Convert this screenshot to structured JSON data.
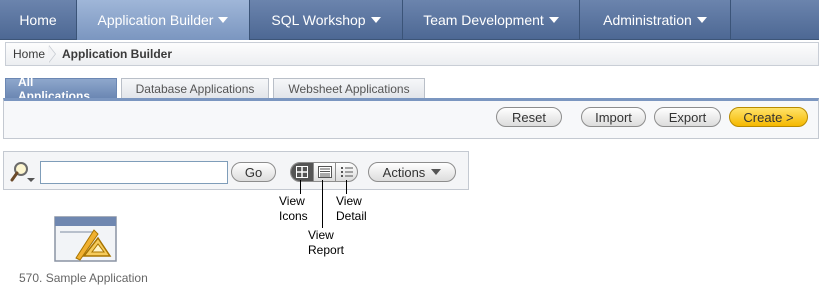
{
  "nav": {
    "tabs": [
      {
        "label": "Home"
      },
      {
        "label": "Application Builder",
        "active": true
      },
      {
        "label": "SQL Workshop"
      },
      {
        "label": "Team Development"
      },
      {
        "label": "Administration"
      }
    ]
  },
  "breadcrumb": {
    "home": "Home",
    "current": "Application Builder"
  },
  "subtabs": [
    "All Applications",
    "Database Applications",
    "Websheet Applications"
  ],
  "buttons": {
    "reset": "Reset",
    "import": "Import",
    "export": "Export",
    "create": "Create >"
  },
  "search": {
    "value": "",
    "go": "Go",
    "actions": "Actions"
  },
  "annotations": {
    "view_icons": [
      "View",
      "Icons"
    ],
    "view_report": [
      "View",
      "Report"
    ],
    "view_detail": [
      "View",
      "Detail"
    ]
  },
  "applications": [
    {
      "label": "570. Sample Application"
    }
  ],
  "colors": {
    "nav": "#4d6894",
    "nav_active": "#8ea7cc",
    "create": "#f5b800"
  }
}
